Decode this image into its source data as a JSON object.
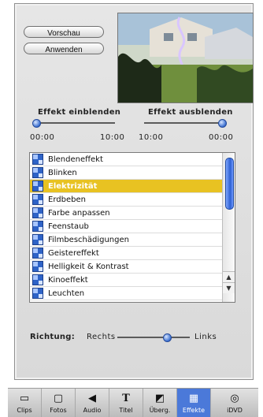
{
  "panel": {
    "buttons": {
      "preview": "Vorschau",
      "apply": "Anwenden"
    },
    "fade_in": {
      "label": "Effekt einblenden",
      "start": "00:00",
      "end": "10:00",
      "value": 0
    },
    "fade_out": {
      "label": "Effekt ausblenden",
      "start": "10:00",
      "end": "00:00",
      "value": 0
    },
    "effects": [
      "Blendeneffekt",
      "Blinken",
      "Elektrizität",
      "Erdbeben",
      "Farbe anpassen",
      "Feenstaub",
      "Filmbeschädigungen",
      "Geistereffekt",
      "Helligkeit & Kontrast",
      "Kinoeffekt",
      "Leuchten"
    ],
    "selected_effect": "Elektrizität",
    "direction": {
      "label": "Richtung:",
      "left": "Rechts",
      "right": "Links",
      "value": 0.62
    }
  },
  "toolbar": {
    "items": [
      {
        "label": "Clips",
        "icon": "clips-icon"
      },
      {
        "label": "Fotos",
        "icon": "photos-icon"
      },
      {
        "label": "Audio",
        "icon": "audio-icon"
      },
      {
        "label": "Titel",
        "icon": "title-icon"
      },
      {
        "label": "Überg.",
        "icon": "transition-icon"
      },
      {
        "label": "Effekte",
        "icon": "effects-icon"
      },
      {
        "label": "iDVD",
        "icon": "idvd-icon"
      }
    ],
    "active": "Effekte"
  },
  "colors": {
    "selection": "#e8c222",
    "accent": "#2e63c7",
    "active_tab": "#4b79d9"
  }
}
